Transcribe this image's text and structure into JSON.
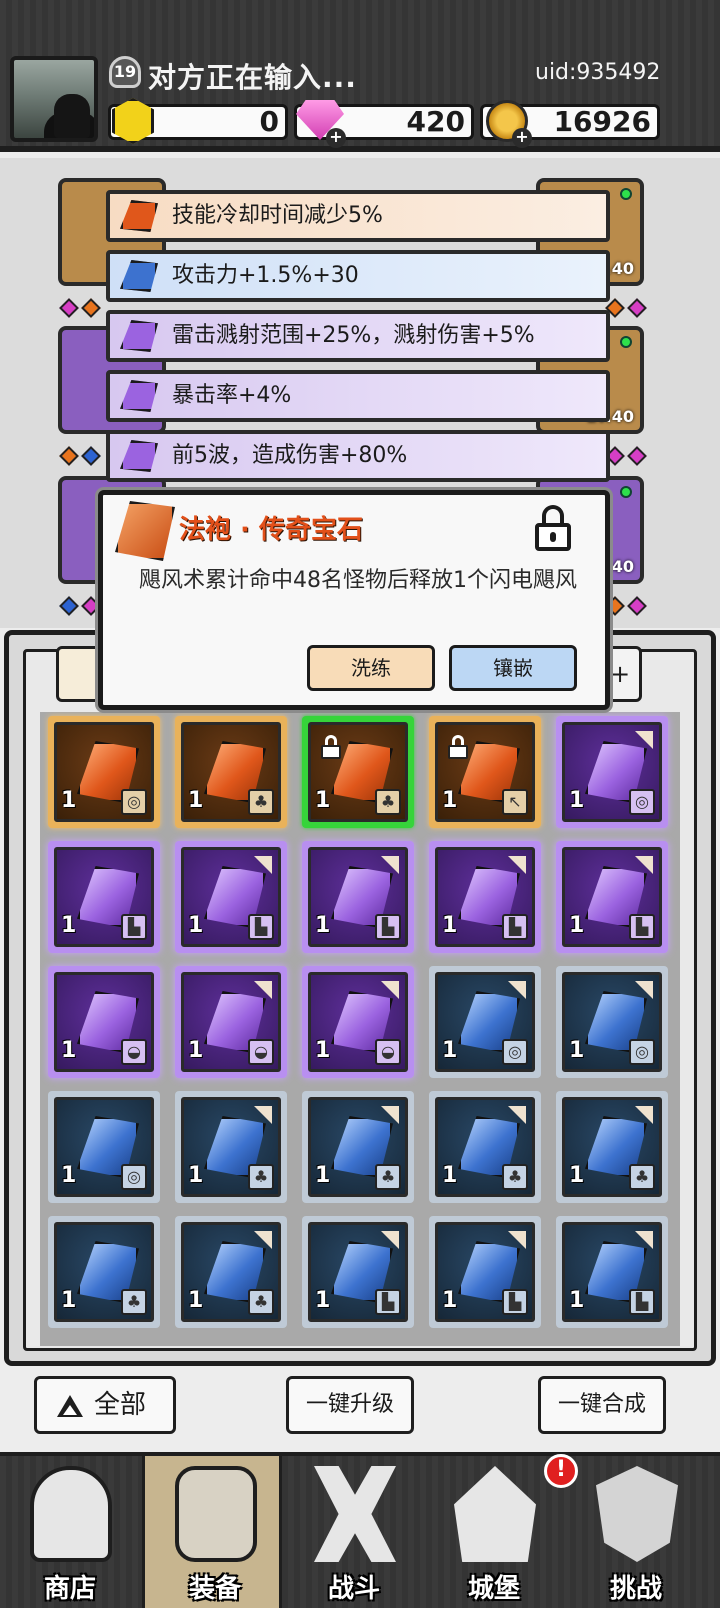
{
  "header": {
    "level": "19",
    "player_name": "对方正在输入...",
    "uid": "uid:935492",
    "gold": "0",
    "gems": "420",
    "coins": "16926"
  },
  "equipment": {
    "slot_levels": [
      "Lv.40",
      "Lv.40",
      "Lv.40"
    ]
  },
  "stats": [
    {
      "text": "技能冷却时间减少5%",
      "rarity": "orange"
    },
    {
      "text": "攻击力+1.5%+30",
      "rarity": "blue"
    },
    {
      "text": "雷击溅射范围+25%，溅射伤害+5%",
      "rarity": "purple"
    },
    {
      "text": "暴击率+4%",
      "rarity": "purple"
    },
    {
      "text": "前5波，造成伤害+80%",
      "rarity": "purple"
    }
  ],
  "popup": {
    "title": "法袍 · 传奇宝石",
    "description": "飓风术累计命中48名怪物后释放1个闪电飓风",
    "refine_label": "洗练",
    "inlay_label": "镶嵌",
    "locked": true
  },
  "inventory": {
    "sort_label": "+",
    "items": [
      {
        "rarity": "orange",
        "count": "1",
        "type_icon": "ring-icon",
        "locked": false,
        "selected": false
      },
      {
        "rarity": "orange",
        "count": "1",
        "type_icon": "robe-icon",
        "locked": false,
        "selected": false
      },
      {
        "rarity": "orange",
        "count": "1",
        "type_icon": "robe-icon",
        "locked": true,
        "selected": true
      },
      {
        "rarity": "orange",
        "count": "1",
        "type_icon": "staff-icon",
        "locked": true,
        "selected": false
      },
      {
        "rarity": "purple",
        "count": "1",
        "type_icon": "ring-icon",
        "locked": false,
        "selected": false
      },
      {
        "rarity": "purple",
        "count": "1",
        "type_icon": "boot-icon",
        "locked": false,
        "selected": false
      },
      {
        "rarity": "purple",
        "count": "1",
        "type_icon": "boot-icon",
        "locked": false,
        "selected": false
      },
      {
        "rarity": "purple",
        "count": "1",
        "type_icon": "boot-icon",
        "locked": false,
        "selected": false
      },
      {
        "rarity": "purple",
        "count": "1",
        "type_icon": "boot-icon",
        "locked": false,
        "selected": false
      },
      {
        "rarity": "purple",
        "count": "1",
        "type_icon": "boot-icon",
        "locked": false,
        "selected": false
      },
      {
        "rarity": "purple",
        "count": "1",
        "type_icon": "hat-icon",
        "locked": false,
        "selected": false
      },
      {
        "rarity": "purple",
        "count": "1",
        "type_icon": "hat-icon",
        "locked": false,
        "selected": false
      },
      {
        "rarity": "purple",
        "count": "1",
        "type_icon": "hat-icon",
        "locked": false,
        "selected": false
      },
      {
        "rarity": "blue",
        "count": "1",
        "type_icon": "ring-icon",
        "locked": false,
        "selected": false
      },
      {
        "rarity": "blue",
        "count": "1",
        "type_icon": "ring-icon",
        "locked": false,
        "selected": false
      },
      {
        "rarity": "blue",
        "count": "1",
        "type_icon": "ring-icon",
        "locked": false,
        "selected": false
      },
      {
        "rarity": "blue",
        "count": "1",
        "type_icon": "robe-icon",
        "locked": false,
        "selected": false
      },
      {
        "rarity": "blue",
        "count": "1",
        "type_icon": "robe-icon",
        "locked": false,
        "selected": false
      },
      {
        "rarity": "blue",
        "count": "1",
        "type_icon": "robe-icon",
        "locked": false,
        "selected": false
      },
      {
        "rarity": "blue",
        "count": "1",
        "type_icon": "robe-icon",
        "locked": false,
        "selected": false
      },
      {
        "rarity": "blue",
        "count": "1",
        "type_icon": "robe-icon",
        "locked": false,
        "selected": false
      },
      {
        "rarity": "blue",
        "count": "1",
        "type_icon": "robe-icon",
        "locked": false,
        "selected": false
      },
      {
        "rarity": "blue",
        "count": "1",
        "type_icon": "boot-icon",
        "locked": false,
        "selected": false
      },
      {
        "rarity": "blue",
        "count": "1",
        "type_icon": "boot-icon",
        "locked": false,
        "selected": false
      },
      {
        "rarity": "blue",
        "count": "1",
        "type_icon": "boot-icon",
        "locked": false,
        "selected": false
      }
    ]
  },
  "actions": {
    "all_label": "全部",
    "upgrade_label": "一键升级",
    "merge_label": "一键合成"
  },
  "nav": {
    "shop": "商店",
    "equip": "装备",
    "battle": "战斗",
    "castle": "城堡",
    "challenge": "挑战",
    "notification": "!"
  },
  "colors": {
    "legendary": "#e2501a",
    "epic": "#9b63e0",
    "rare": "#3d72cf",
    "selected": "#36d43a"
  }
}
